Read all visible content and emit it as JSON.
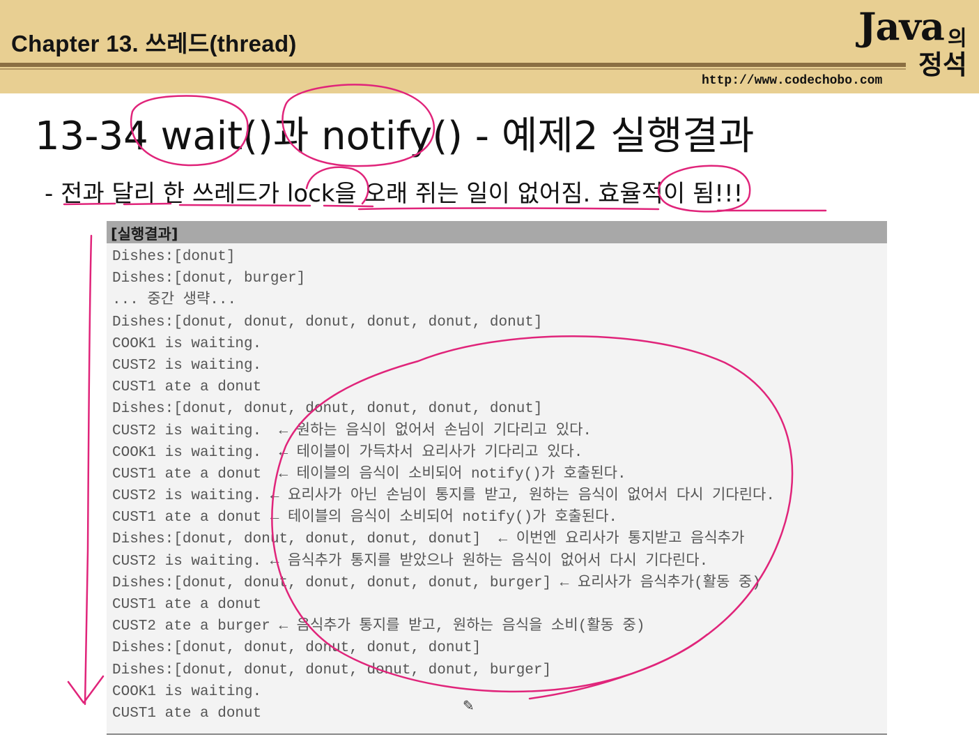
{
  "header": {
    "chapter_title": "Chapter 13. 쓰레드(thread)",
    "logo_java": "Java",
    "logo_ui": "의",
    "logo_jeongseok": "정석",
    "url": "http://www.codechobo.com"
  },
  "slide": {
    "title": "13-34 wait()과 notify() - 예제2 실행결과",
    "subtitle": "- 전과 달리 한 쓰레드가 lock을 오래 쥐는 일이 없어짐. 효율적이 됨!!!"
  },
  "result": {
    "heading": "[실행결과]",
    "lines": [
      "Dishes:[donut]",
      "Dishes:[donut, burger]",
      "... 중간 생략...",
      "Dishes:[donut, donut, donut, donut, donut, donut]",
      "COOK1 is waiting.",
      "CUST2 is waiting.",
      "CUST1 ate a donut",
      "Dishes:[donut, donut, donut, donut, donut, donut]",
      "CUST2 is waiting.  ← 원하는 음식이 없어서 손님이 기다리고 있다.",
      "COOK1 is waiting.  ← 테이블이 가득차서 요리사가 기다리고 있다.",
      "CUST1 ate a donut  ← 테이블의 음식이 소비되어 notify()가 호출된다.",
      "CUST2 is waiting. ← 요리사가 아닌 손님이 통지를 받고, 원하는 음식이 없어서 다시 기다린다.",
      "CUST1 ate a donut ← 테이블의 음식이 소비되어 notify()가 호출된다.",
      "Dishes:[donut, donut, donut, donut, donut]  ← 이번엔 요리사가 통지받고 음식추가",
      "CUST2 is waiting. ← 음식추가 통지를 받았으나 원하는 음식이 없어서 다시 기다린다.",
      "Dishes:[donut, donut, donut, donut, donut, burger] ← 요리사가 음식추가(활동 중)",
      "CUST1 ate a donut",
      "CUST2 ate a burger ← 음식추가 통지를 받고, 원하는 음식을 소비(활동 중)",
      "Dishes:[donut, donut, donut, donut, donut]",
      "Dishes:[donut, donut, donut, donut, donut, burger]",
      "COOK1 is waiting.",
      "CUST1 ate a donut"
    ]
  },
  "colors": {
    "header_bg": "#e8cf92",
    "rule": "#8b6f42",
    "annotation_ink": "#e0247a",
    "result_header": "#a8a8a8",
    "result_bg": "#f3f3f3"
  },
  "icons": [
    "pencil-cursor-icon"
  ]
}
